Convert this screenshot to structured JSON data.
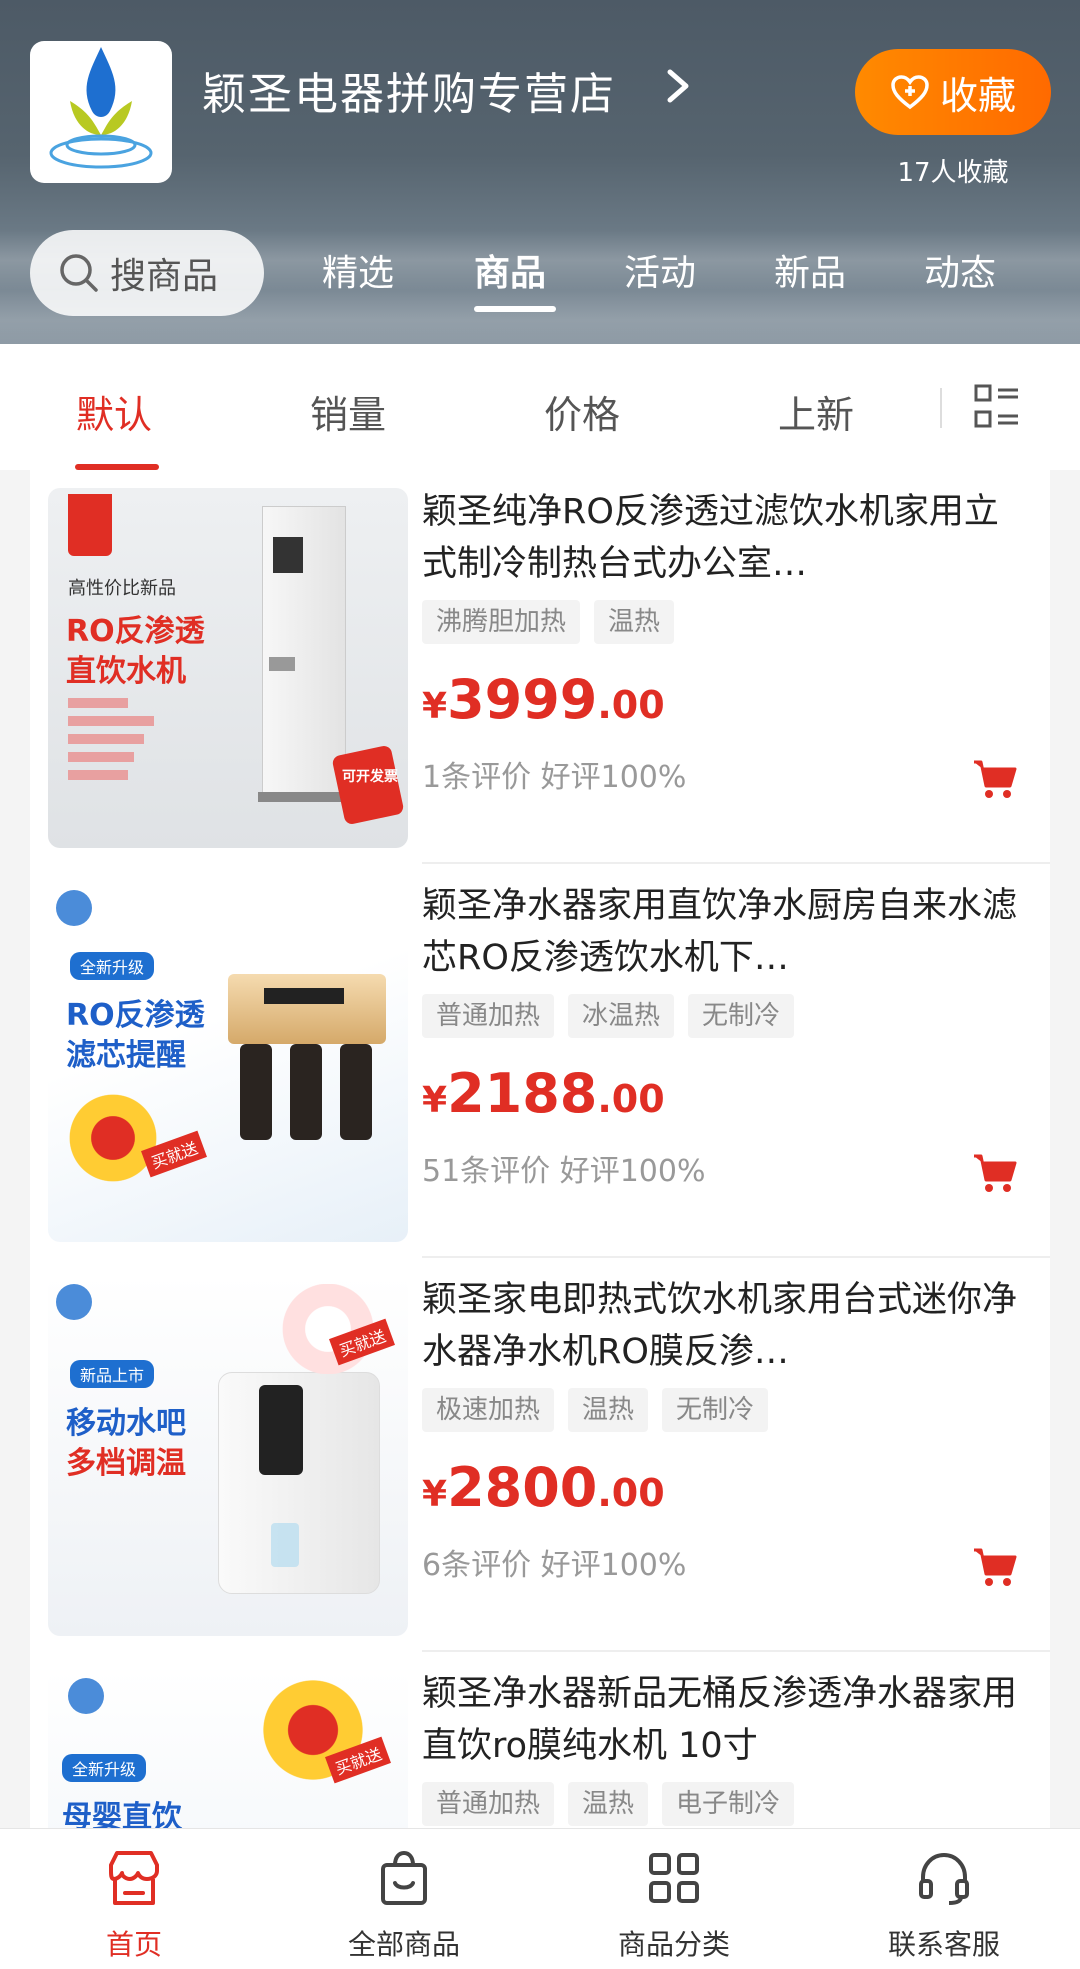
{
  "shop": {
    "name": "颖圣电器拼购专营店",
    "fav_label": "收藏",
    "fav_count": "17人收藏"
  },
  "search": {
    "placeholder": "搜商品"
  },
  "top_tabs": [
    {
      "label": "精选"
    },
    {
      "label": "商品",
      "active": true
    },
    {
      "label": "活动"
    },
    {
      "label": "新品"
    },
    {
      "label": "动态"
    }
  ],
  "sort": [
    {
      "label": "默认",
      "active": true
    },
    {
      "label": "销量"
    },
    {
      "label": "价格"
    },
    {
      "label": "上新"
    }
  ],
  "products": [
    {
      "title": "颖圣纯净RO反渗透过滤饮水机家用立式制冷制热台式办公室…",
      "tags": [
        "沸腾胆加热",
        "温热"
      ],
      "price_cur": "¥",
      "price_int": "3999",
      "price_dec": ".00",
      "reviews": "1条评价  好评100%",
      "thumb": {
        "line1": "高性价比新品",
        "line2": "RO反渗透",
        "line3": "直饮水机",
        "badge": "可开发票"
      }
    },
    {
      "title": "颖圣净水器家用直饮净水厨房自来水滤芯RO反渗透饮水机下…",
      "tags": [
        "普通加热",
        "冰温热",
        "无制冷"
      ],
      "price_cur": "¥",
      "price_int": "2188",
      "price_dec": ".00",
      "reviews": "51条评价  好评100%",
      "thumb": {
        "line1": "全新升级",
        "line2": "RO反渗透",
        "line3": "滤芯提醒",
        "badge": "买就送"
      }
    },
    {
      "title": "颖圣家电即热式饮水机家用台式迷你净水器净水机RO膜反渗…",
      "tags": [
        "极速加热",
        "温热",
        "无制冷"
      ],
      "price_cur": "¥",
      "price_int": "2800",
      "price_dec": ".00",
      "reviews": "6条评价  好评100%",
      "thumb": {
        "line1": "新品上市",
        "line2": "移动水吧",
        "line3": "多档调温",
        "badge": "买就送"
      }
    },
    {
      "title": "颖圣净水器新品无桶反渗透净水器家用直饮ro膜纯水机 10寸",
      "tags": [
        "普通加热",
        "温热",
        "电子制冷"
      ],
      "thumb": {
        "line1": "全新升级",
        "line2": "母婴直饮",
        "line3": "",
        "badge": "买就送"
      }
    }
  ],
  "bottom_nav": [
    {
      "label": "首页",
      "icon": "shop-home-icon",
      "active": true
    },
    {
      "label": "全部商品",
      "icon": "shopping-bag-icon"
    },
    {
      "label": "商品分类",
      "icon": "category-grid-icon"
    },
    {
      "label": "联系客服",
      "icon": "headset-icon"
    }
  ],
  "colors": {
    "accent": "#e02e24",
    "fav": "#ff7a00"
  }
}
